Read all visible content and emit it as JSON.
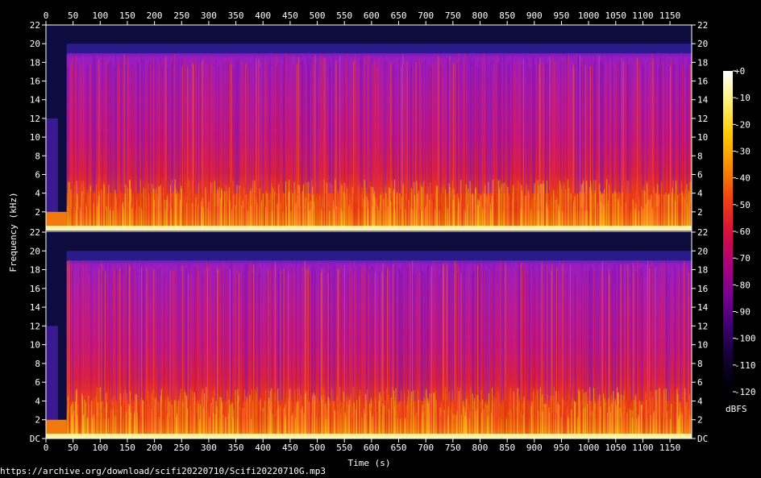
{
  "chart_data": {
    "type": "heatmap",
    "subtype": "spectrogram",
    "channels": 2,
    "xlabel": "Time (s)",
    "ylabel": "Frequency (kHz)",
    "xlim": [
      0,
      1190
    ],
    "x_ticks": [
      0,
      50,
      100,
      150,
      200,
      250,
      300,
      350,
      400,
      450,
      500,
      550,
      600,
      650,
      700,
      750,
      800,
      850,
      900,
      950,
      1000,
      1050,
      1100,
      1150
    ],
    "x_tick_labels": [
      "0",
      "50",
      "100",
      "150",
      "200",
      "250",
      "300",
      "350",
      "400",
      "450",
      "500",
      "550",
      "600",
      "650",
      "700",
      "750",
      "800",
      "850",
      "900",
      "950",
      "1000",
      "1050",
      "1100",
      "1150"
    ],
    "ylim_khz": [
      0,
      22
    ],
    "y_ticks": [
      0,
      2,
      4,
      6,
      8,
      10,
      12,
      14,
      16,
      18,
      20,
      22
    ],
    "y_tick_labels_top": [
      "22",
      "20",
      "18",
      "16",
      "14",
      "12",
      "10",
      "8",
      "6",
      "4",
      "2"
    ],
    "y_tick_labels_bottom": [
      "DC",
      "2",
      "4",
      "6",
      "8",
      "10",
      "12",
      "14",
      "16",
      "18",
      "20",
      "22"
    ],
    "colorbar": {
      "label": "dBFS",
      "range": [
        -120,
        0
      ],
      "ticks": [
        0,
        -10,
        -20,
        -30,
        -40,
        -50,
        -60,
        -70,
        -80,
        -90,
        -100,
        -110,
        -120
      ],
      "tick_labels": [
        "+0",
        "-10",
        "-20",
        "-30",
        "-40",
        "-50",
        "-60",
        "-70",
        "-80",
        "-90",
        "-100",
        "-110",
        "-120"
      ],
      "colors": [
        "#000000",
        "#100030",
        "#3a0070",
        "#7a0090",
        "#b0007a",
        "#d8103a",
        "#f04010",
        "#f88a00",
        "#fcc800",
        "#fff070",
        "#ffffff"
      ]
    },
    "lowpass_cutoff_khz": 19,
    "silence_end_s": 38,
    "grid": false
  },
  "footer": {
    "source_url": "https://archive.org/download/scifi20220710/Scifi20220710G.mp3"
  }
}
